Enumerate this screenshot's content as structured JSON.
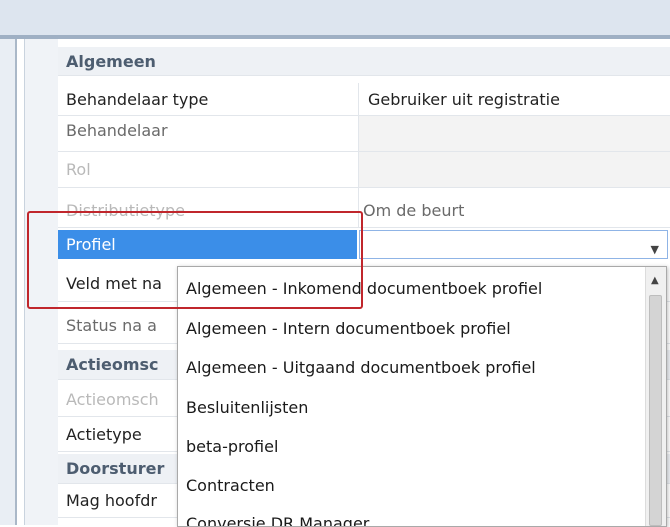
{
  "sections": {
    "algemeen": "Algemeen",
    "actieomschrijving": "Actieomsc",
    "doorsturen": "Doorsturer"
  },
  "rows": {
    "behandelaar_type": {
      "label": "Behandelaar type",
      "value": "Gebruiker uit registratie"
    },
    "behandelaar": {
      "label": "Behandelaar"
    },
    "rol": {
      "label": "Rol"
    },
    "distributietype": {
      "label": "Distributietype",
      "value": "Om de beurt"
    },
    "profiel": {
      "label": "Profiel",
      "value": ""
    },
    "veld_met": {
      "label": "Veld met na"
    },
    "status_na": {
      "label": "Status na a"
    },
    "actieomschrijving_field": {
      "label": "Actieomsch"
    },
    "actietype": {
      "label": "Actietype"
    },
    "mag_hoofd": {
      "label": "Mag hoofdr"
    }
  },
  "dropdown": {
    "options": [
      "Algemeen - Inkomend documentboek profiel",
      "Algemeen - Intern documentboek profiel",
      "Algemeen - Uitgaand documentboek profiel",
      "Besluitenlijsten",
      "beta-profiel",
      "Contracten",
      "Conversie DR Manager"
    ]
  },
  "colors": {
    "selection": "#3b8ee8",
    "highlight_box": "#c0262c",
    "section_text": "#4d5d70"
  },
  "icons": {
    "combo_arrow": "chevron-down-icon",
    "scroll_up": "scroll-up-arrow-icon"
  }
}
